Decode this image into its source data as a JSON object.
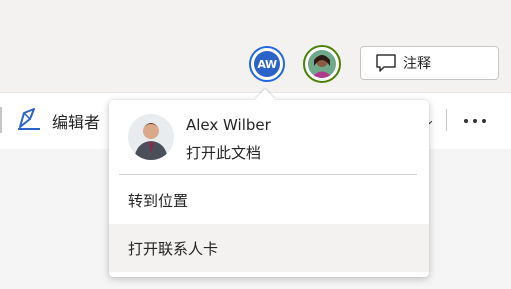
{
  "header": {
    "current_user_initials": "AW",
    "comments_label": "注释"
  },
  "ribbon": {
    "editor_label": "编辑者"
  },
  "contact_card": {
    "name": "Alex Wilber",
    "open_doc_label": "打开此文档",
    "goto_location_label": "转到位置",
    "open_contact_card_label": "打开联系人卡"
  },
  "colors": {
    "active_user_ring": "#2266e3",
    "collaborator_ring": "#498205",
    "avatar_fill": "#2b63c8"
  },
  "icons": [
    "comment-icon",
    "editor-pen-icon",
    "more-icon",
    "chevron-down-icon"
  ]
}
